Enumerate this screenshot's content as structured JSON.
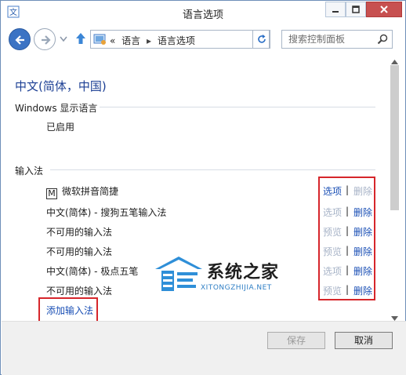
{
  "window": {
    "title": "语言选项"
  },
  "address_bar": {
    "prefix": "«",
    "crumbs": [
      "语言",
      "语言选项"
    ]
  },
  "search": {
    "placeholder": "搜索控制面板"
  },
  "page": {
    "title": "中文(简体，中国)",
    "display_language": {
      "heading": "Windows 显示语言",
      "status": "已启用"
    },
    "input_methods": {
      "heading": "输入法",
      "items": [
        {
          "badge": "M",
          "name": "微软拼音简捷",
          "option": "选项",
          "option_enabled": true,
          "separator": "|",
          "remove": "删除",
          "remove_enabled": false
        },
        {
          "badge": "",
          "name": "中文(简体) - 搜狗五笔输入法",
          "option": "选项",
          "option_enabled": false,
          "separator": "|",
          "remove": "删除",
          "remove_enabled": true
        },
        {
          "badge": "",
          "name": "不可用的输入法",
          "option": "预览",
          "option_enabled": false,
          "separator": "|",
          "remove": "删除",
          "remove_enabled": true
        },
        {
          "badge": "",
          "name": "不可用的输入法",
          "option": "预览",
          "option_enabled": false,
          "separator": "|",
          "remove": "删除",
          "remove_enabled": true
        },
        {
          "badge": "",
          "name": "中文(简体) - 极点五笔",
          "option": "选项",
          "option_enabled": false,
          "separator": "|",
          "remove": "删除",
          "remove_enabled": true
        },
        {
          "badge": "",
          "name": "不可用的输入法",
          "option": "预览",
          "option_enabled": false,
          "separator": "|",
          "remove": "删除",
          "remove_enabled": true
        }
      ],
      "add_link": "添加输入法"
    }
  },
  "footer": {
    "save_label": "保存",
    "cancel_label": "取消"
  },
  "watermark": {
    "text": "系统之家",
    "url": "XITONGZHIJIA.NET"
  },
  "colors": {
    "link": "#1a4fb5",
    "link_disabled": "#a7b3c7",
    "title": "#1c3f94",
    "highlight": "#d6262b",
    "close_button": "#c75050"
  }
}
